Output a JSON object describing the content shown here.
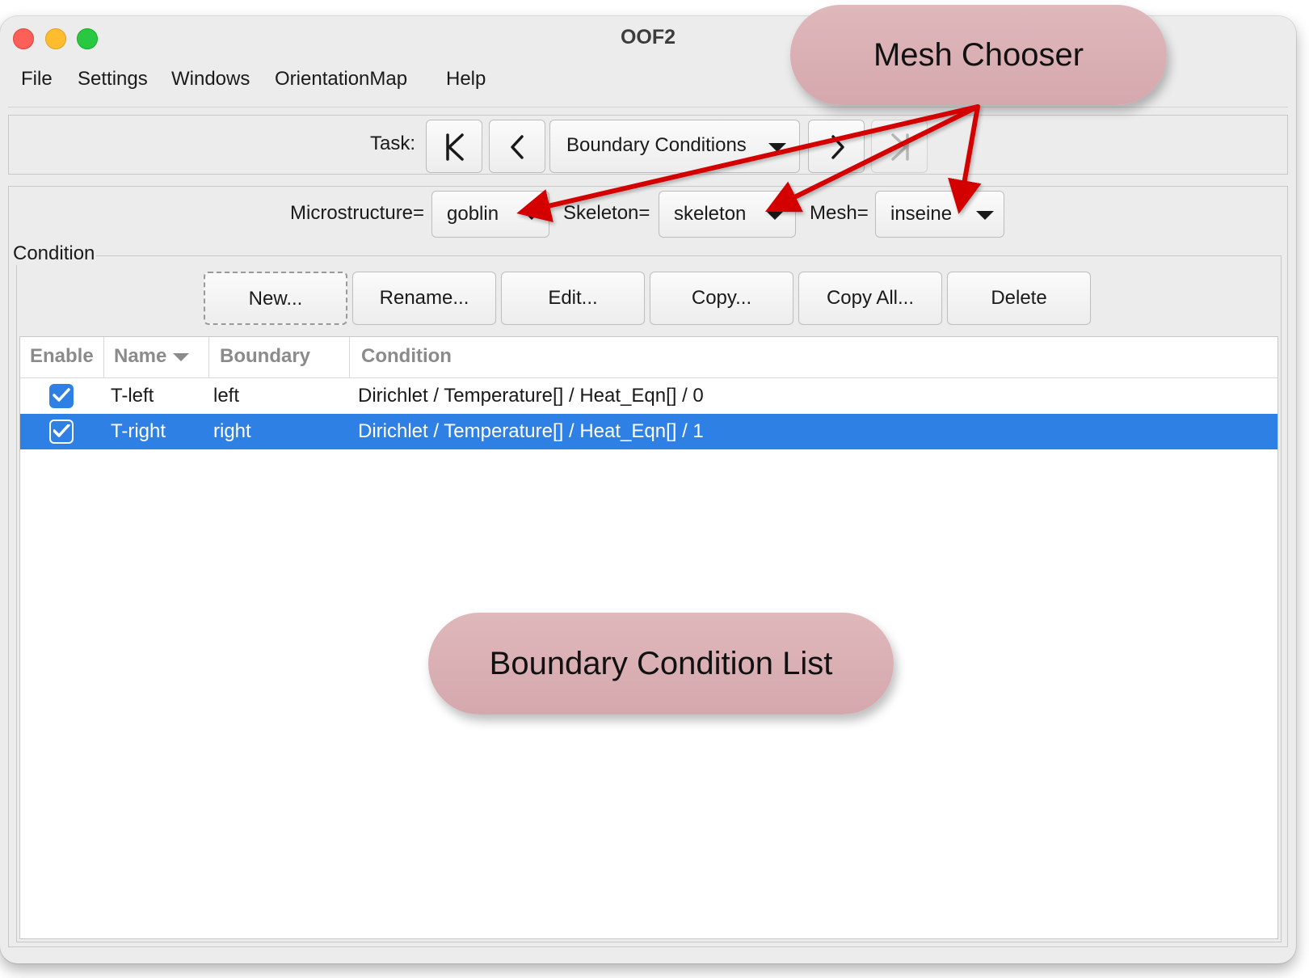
{
  "window": {
    "title": "OOF2"
  },
  "menubar": {
    "items": [
      "File",
      "Settings",
      "Windows",
      "OrientationMap",
      "Help"
    ]
  },
  "task": {
    "label": "Task:",
    "current": "Boundary Conditions"
  },
  "chooser": {
    "microstructure_label": "Microstructure=",
    "microstructure_value": "goblin",
    "skeleton_label": "Skeleton=",
    "skeleton_value": "skeleton",
    "mesh_label": "Mesh=",
    "mesh_value": "inseine"
  },
  "condition_group": {
    "title": "Condition",
    "buttons": [
      "New...",
      "Rename...",
      "Edit...",
      "Copy...",
      "Copy All...",
      "Delete"
    ]
  },
  "table": {
    "columns": [
      "Enable",
      "Name",
      "Boundary",
      "Condition"
    ],
    "rows": [
      {
        "enabled": true,
        "name": "T-left",
        "boundary": "left",
        "condition": "Dirichlet / Temperature[] / Heat_Eqn[] / 0",
        "selected": false
      },
      {
        "enabled": true,
        "name": "T-right",
        "boundary": "right",
        "condition": "Dirichlet / Temperature[] / Heat_Eqn[] / 1",
        "selected": true
      }
    ]
  },
  "annotations": {
    "mesh_chooser": "Mesh Chooser",
    "bc_list": "Boundary Condition List",
    "arrow_color": "#d40000"
  },
  "colors": {
    "selection": "#2f80e5",
    "callout": "#d9aeb2"
  }
}
